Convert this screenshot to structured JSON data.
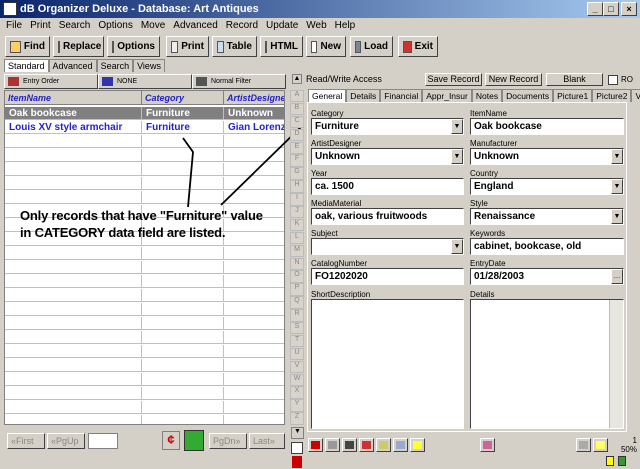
{
  "window": {
    "title": "dB Organizer Deluxe - Database: Art Antiques",
    "min": "_",
    "max": "□",
    "close": "×"
  },
  "menu": [
    "File",
    "Print",
    "Search",
    "Options",
    "Move",
    "Advanced",
    "Record",
    "Update",
    "Web",
    "Help"
  ],
  "toolbar": [
    {
      "label": "Find",
      "icon": "key-icon"
    },
    {
      "label": "Replace",
      "icon": "replace-icon"
    },
    {
      "label": "Options",
      "icon": "options-icon"
    },
    {
      "label": "Print",
      "icon": "printer-icon"
    },
    {
      "label": "Table",
      "icon": "table-icon"
    },
    {
      "label": "HTML",
      "icon": "html-icon"
    },
    {
      "label": "New",
      "icon": "new-page-icon"
    },
    {
      "label": "Load",
      "icon": "load-icon"
    },
    {
      "label": "Exit",
      "icon": "exit-icon"
    }
  ],
  "search_tabs": [
    "Standard",
    "Advanced",
    "Search",
    "Views"
  ],
  "sort_bar": [
    "Entry Order",
    "NONE",
    "Normal Filter"
  ],
  "grid": {
    "columns": [
      "ItemName",
      "Category",
      "ArtistDesigner"
    ],
    "rows": [
      [
        "Oak bookcase",
        "Furniture",
        "Unknown"
      ],
      [
        "Louis XV style armchair",
        "Furniture",
        "Gian Lorenzo"
      ]
    ]
  },
  "annotation": {
    "line1": "Only records that have \"Furniture\" value",
    "line2": "in CATEGORY data field are listed."
  },
  "nav": {
    "first": "First",
    "pgup": "PgUp",
    "pgdn": "PgDn",
    "last": "Last"
  },
  "record_panel": {
    "access": "Read/Write Access",
    "save": "Save Record",
    "new": "New Record",
    "blank": "Blank",
    "ro": "RO"
  },
  "letters": [
    "A",
    "B",
    "C",
    "D",
    "E",
    "F",
    "G",
    "H",
    "I",
    "J",
    "K",
    "L",
    "M",
    "N",
    "O",
    "P",
    "Q",
    "R",
    "S",
    "T",
    "U",
    "V",
    "W",
    "X",
    "Y",
    "Z"
  ],
  "form_tabs": [
    "General",
    "Details",
    "Financial",
    "Appr_Insur",
    "Notes",
    "Documents",
    "Picture1",
    "Picture2",
    "Vi"
  ],
  "fields": {
    "category": {
      "label": "Category",
      "value": "Furniture"
    },
    "itemname": {
      "label": "ItemName",
      "value": "Oak bookcase"
    },
    "artist": {
      "label": "ArtistDesigner",
      "value": "Unknown"
    },
    "manufacturer": {
      "label": "Manufacturer",
      "value": "Unknown"
    },
    "year": {
      "label": "Year",
      "value": "ca. 1500"
    },
    "country": {
      "label": "Country",
      "value": "England"
    },
    "media": {
      "label": "MediaMaterial",
      "value": "oak, various fruitwoods"
    },
    "style": {
      "label": "Style",
      "value": "Renaissance"
    },
    "subject": {
      "label": "Subject",
      "value": ""
    },
    "keywords": {
      "label": "Keywords",
      "value": "cabinet, bookcase, old"
    },
    "catalog": {
      "label": "CatalogNumber",
      "value": "FO1202020"
    },
    "entrydate": {
      "label": "EntryDate",
      "value": "01/28/2003"
    },
    "shortdesc": {
      "label": "ShortDescription"
    },
    "details": {
      "label": "Details"
    }
  },
  "status": {
    "record": "1",
    "zoom": "50%"
  }
}
